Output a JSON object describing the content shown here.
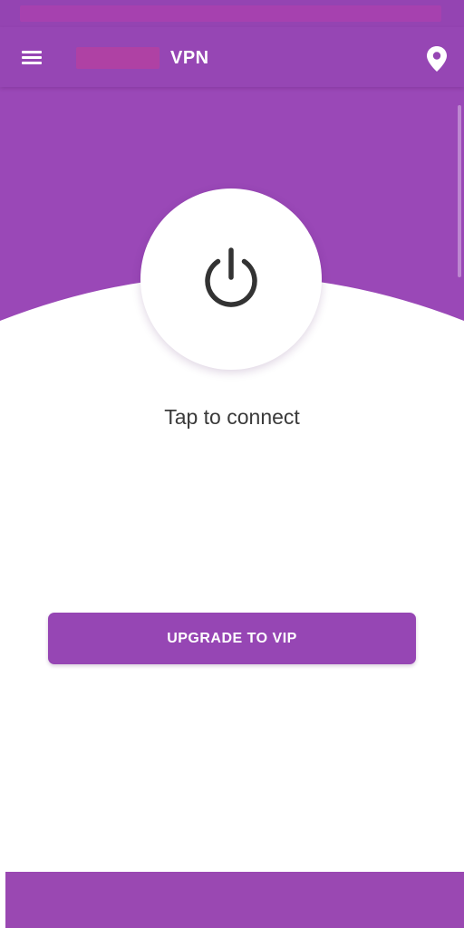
{
  "app_bar": {
    "title": "VPN",
    "menu_icon": "hamburger-menu-icon",
    "location_icon": "map-pin-icon"
  },
  "main": {
    "power_icon": "power-icon",
    "connect_label": "Tap to connect",
    "upgrade_label": "UPGRADE TO VIP"
  },
  "colors": {
    "primary": "#9a48b7",
    "app_bar": "#9646b4",
    "icon": "#333333",
    "text": "#3a3a3a",
    "background": "#ffffff"
  }
}
